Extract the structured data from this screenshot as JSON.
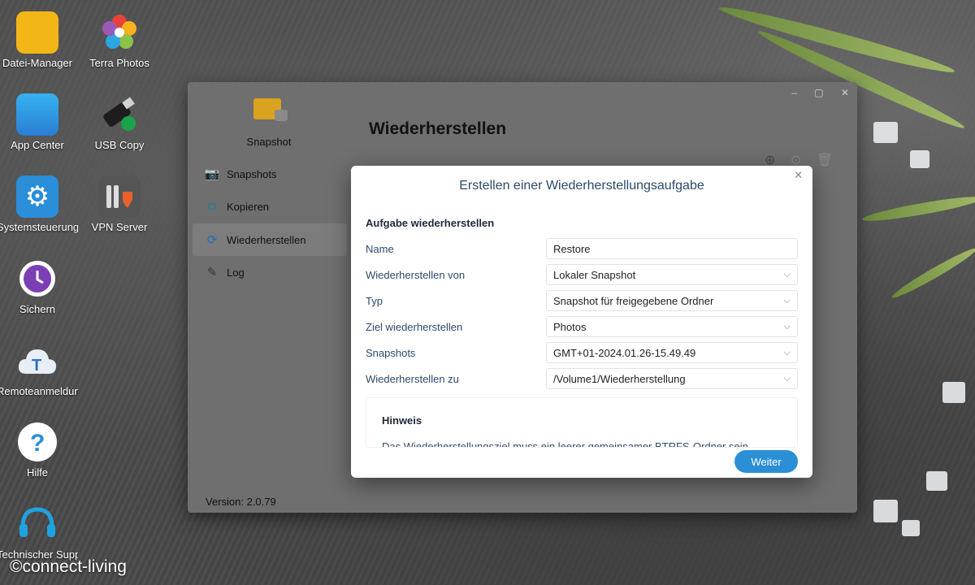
{
  "desktop": {
    "icons": [
      {
        "label": "Datei-Manager"
      },
      {
        "label": "Terra Photos"
      },
      {
        "label": "App Center"
      },
      {
        "label": "USB Copy"
      },
      {
        "label": "Systemsteuerung"
      },
      {
        "label": "VPN Server"
      },
      {
        "label": "Sichern"
      },
      {
        "label": "Remoteanmeldung"
      },
      {
        "label": "Hilfe"
      },
      {
        "label": "Technischer Support"
      }
    ]
  },
  "window": {
    "app_name": "Snapshot",
    "page_title": "Wiederherstellen",
    "sidebar": [
      {
        "label": "Snapshots"
      },
      {
        "label": "Kopieren"
      },
      {
        "label": "Wiederherstellen"
      },
      {
        "label": "Log"
      }
    ],
    "version": "Version: 2.0.79"
  },
  "dialog": {
    "title": "Erstellen einer Wiederherstellungsaufgabe",
    "section": "Aufgabe wiederherstellen",
    "fields": [
      {
        "label": "Name",
        "value": "Restore"
      },
      {
        "label": "Wiederherstellen von",
        "value": "Lokaler Snapshot"
      },
      {
        "label": "Typ",
        "value": "Snapshot für freigegebene Ordner"
      },
      {
        "label": "Ziel wiederherstellen",
        "value": "Photos"
      },
      {
        "label": "Snapshots",
        "value": "GMT+01-2024.01.26-15.49.49"
      },
      {
        "label": "Wiederherstellen zu",
        "value": "/Volume1/Wiederherstellung"
      }
    ],
    "hint_title": "Hinweis",
    "hint_text": "Das Wiederherstellungsziel muss ein leerer gemeinsamer BTRFS-Ordner sein.",
    "next_label": "Weiter"
  },
  "watermark": "©connect-living",
  "colors": {
    "accent": "#2b8fd6",
    "title_text": "#2c4a6a"
  }
}
